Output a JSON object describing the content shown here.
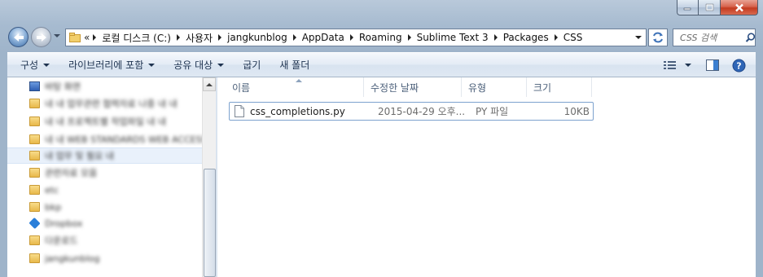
{
  "window": {
    "caption_buttons": [
      "minimize",
      "maximize",
      "close"
    ]
  },
  "navigation": {
    "back_icon": "back-arrow-icon",
    "forward_icon": "forward-arrow-icon"
  },
  "address_bar": {
    "overflow_chevrons": "«",
    "crumbs": [
      "로컬 디스크 (C:)",
      "사용자",
      "jangkunblog",
      "AppData",
      "Roaming",
      "Sublime Text 3",
      "Packages",
      "CSS"
    ]
  },
  "search": {
    "placeholder": "CSS 검색"
  },
  "toolbar": {
    "organize": "구성",
    "include_in_library": "라이브러리에 포함",
    "share_with": "공유 대상",
    "burn": "굽기",
    "new_folder": "새 폴더"
  },
  "nav_pane": {
    "items": [
      {
        "label": "바탕 화면",
        "icon": "computer-icon",
        "blurred": true
      },
      {
        "label": "내 내 업무관련 협력자료 나중 내 내",
        "icon": "folder-icon",
        "blurred": true
      },
      {
        "label": "내 내 프로젝트별 작업파일 내 내",
        "icon": "folder-icon",
        "blurred": true
      },
      {
        "label": "내 내 WEB STANDARDS WEB ACCESSIBILITY",
        "icon": "folder-icon",
        "blurred": true
      },
      {
        "label": "내 업무 및 필요 내",
        "icon": "folder-icon",
        "blurred": true,
        "selected": true
      },
      {
        "label": "관련자료 모음",
        "icon": "folder-icon",
        "blurred": true
      },
      {
        "label": "etc",
        "icon": "folder-icon",
        "blurred": true
      },
      {
        "label": "bkp",
        "icon": "folder-icon",
        "blurred": true
      },
      {
        "label": "Dropbox",
        "icon": "dropbox-icon",
        "blurred": true
      },
      {
        "label": "다운로드",
        "icon": "folder-icon",
        "blurred": true
      },
      {
        "label": "jangkunblog",
        "icon": "folder-icon",
        "blurred": true
      }
    ]
  },
  "content": {
    "columns": [
      "이름",
      "수정한 날짜",
      "유형",
      "크기"
    ],
    "files": [
      {
        "name": "css_completions.py",
        "modified": "2015-04-29 오후...",
        "type": "PY 파일",
        "size": "10KB"
      }
    ]
  },
  "colors": {
    "frame": "#a7bbd0",
    "selection_border": "#7da2ce",
    "toolbar_text": "#1e3350"
  }
}
